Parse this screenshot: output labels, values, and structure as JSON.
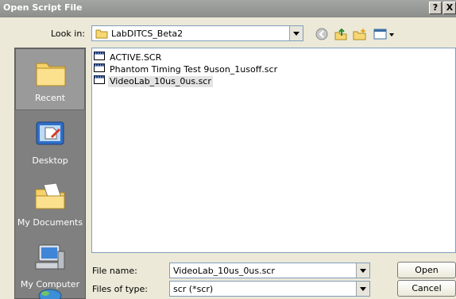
{
  "window": {
    "title": "Open Script File",
    "help_label": "?",
    "close_label": "X"
  },
  "lookin": {
    "label": "Look in:",
    "value": "LabDITCS_Beta2"
  },
  "toolbar": {
    "icons": [
      "back-icon",
      "up-folder-icon",
      "new-folder-icon",
      "view-menu-icon"
    ]
  },
  "places": [
    {
      "label": "Recent",
      "icon": "recent-folder-icon"
    },
    {
      "label": "Desktop",
      "icon": "desktop-icon"
    },
    {
      "label": "My Documents",
      "icon": "my-documents-icon"
    },
    {
      "label": "My Computer",
      "icon": "my-computer-icon"
    }
  ],
  "files": [
    {
      "name": "ACTIVE.SCR"
    },
    {
      "name": "Phantom Timing Test 9uson_1usoff.scr"
    },
    {
      "name": "VideoLab_10us_0us.scr"
    }
  ],
  "selected_file": "VideoLab_10us_0us.scr",
  "filename": {
    "label": "File name:",
    "value": "VideoLab_10us_0us.scr"
  },
  "filetype": {
    "label": "Files of type:",
    "value": "scr (*scr)"
  },
  "buttons": {
    "open": "Open",
    "cancel": "Cancel"
  },
  "colors": {
    "titlebar": "#9a9c99",
    "places_bg": "#808080",
    "dialog_bg": "#ece9d8",
    "selection": "#e3e3e3"
  }
}
